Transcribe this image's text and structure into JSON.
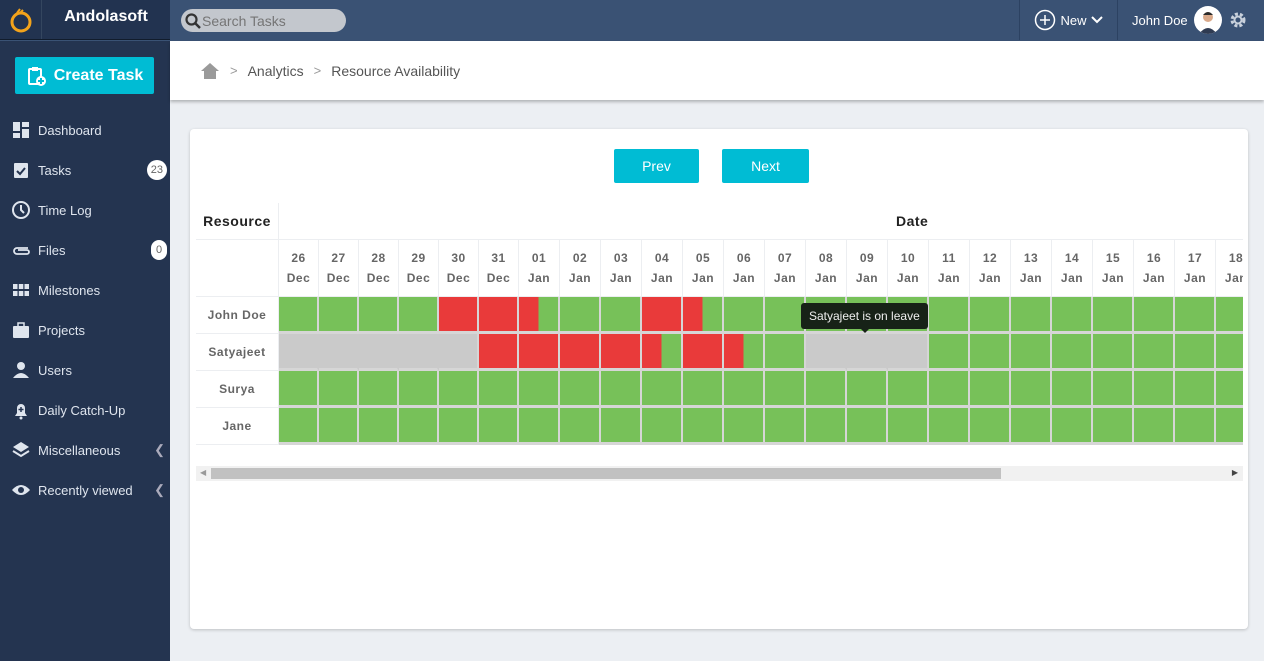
{
  "app": {
    "brand": "Andolasoft",
    "search_placeholder": "Search Tasks",
    "new_label": "New",
    "user_name": "John Doe"
  },
  "sidebar": {
    "create_label": "Create Task",
    "items": [
      {
        "label": "Dashboard",
        "icon": "dashboard-icon"
      },
      {
        "label": "Tasks",
        "icon": "clipboard-check-icon",
        "badge": "23"
      },
      {
        "label": "Time Log",
        "icon": "clock-icon"
      },
      {
        "label": "Files",
        "icon": "paperclip-icon",
        "badge": "0"
      },
      {
        "label": "Milestones",
        "icon": "grid-icon"
      },
      {
        "label": "Projects",
        "icon": "briefcase-icon"
      },
      {
        "label": "Users",
        "icon": "user-icon"
      },
      {
        "label": "Daily Catch-Up",
        "icon": "bell-plus-icon"
      },
      {
        "label": "Miscellaneous",
        "icon": "layers-icon",
        "expandable": true
      },
      {
        "label": "Recently viewed",
        "icon": "eye-icon",
        "expandable": true
      }
    ]
  },
  "breadcrumb": {
    "items": [
      "Analytics",
      "Resource Availability"
    ]
  },
  "nav_buttons": {
    "prev": "Prev",
    "next": "Next"
  },
  "table": {
    "resource_header": "Resource",
    "date_header": "Date",
    "dates": [
      [
        "26",
        "Dec"
      ],
      [
        "27",
        "Dec"
      ],
      [
        "28",
        "Dec"
      ],
      [
        "29",
        "Dec"
      ],
      [
        "30",
        "Dec"
      ],
      [
        "31",
        "Dec"
      ],
      [
        "01",
        "Jan"
      ],
      [
        "02",
        "Jan"
      ],
      [
        "03",
        "Jan"
      ],
      [
        "04",
        "Jan"
      ],
      [
        "05",
        "Jan"
      ],
      [
        "06",
        "Jan"
      ],
      [
        "07",
        "Jan"
      ],
      [
        "08",
        "Jan"
      ],
      [
        "09",
        "Jan"
      ],
      [
        "10",
        "Jan"
      ],
      [
        "11",
        "Jan"
      ],
      [
        "12",
        "Jan"
      ],
      [
        "13",
        "Jan"
      ],
      [
        "14",
        "Jan"
      ],
      [
        "15",
        "Jan"
      ],
      [
        "16",
        "Jan"
      ],
      [
        "17",
        "Jan"
      ],
      [
        "18",
        "Jan"
      ]
    ],
    "legend_status": {
      "g": "available",
      "r": "busy",
      "h": "half-busy",
      "l": "on-leave"
    },
    "rows": [
      {
        "name": "John Doe",
        "cells": [
          "g",
          "g",
          "g",
          "g",
          "r",
          "r",
          "h",
          "g",
          "g",
          "r",
          "h",
          "g",
          "g",
          "g",
          "g",
          "g",
          "g",
          "g",
          "g",
          "g",
          "g",
          "g",
          "g",
          "g"
        ]
      },
      {
        "name": "Satyajeet",
        "cells": [
          "l",
          "l",
          "l",
          "l",
          "l",
          "r",
          "r",
          "r",
          "r",
          "h",
          "r",
          "h",
          "g",
          "l",
          "l",
          "l",
          "g",
          "g",
          "g",
          "g",
          "g",
          "g",
          "g",
          "g"
        ]
      },
      {
        "name": "Surya",
        "cells": [
          "g",
          "g",
          "g",
          "g",
          "g",
          "g",
          "g",
          "g",
          "g",
          "g",
          "g",
          "g",
          "g",
          "g",
          "g",
          "g",
          "g",
          "g",
          "g",
          "g",
          "g",
          "g",
          "g",
          "g"
        ]
      },
      {
        "name": "Jane",
        "cells": [
          "g",
          "g",
          "g",
          "g",
          "g",
          "g",
          "g",
          "g",
          "g",
          "g",
          "g",
          "g",
          "g",
          "g",
          "g",
          "g",
          "g",
          "g",
          "g",
          "g",
          "g",
          "g",
          "g",
          "g"
        ]
      }
    ]
  },
  "tooltip": "Satyajeet is on leave",
  "colors": {
    "available": "#77c159",
    "busy": "#e93a3a",
    "leave": "#cacaca",
    "accent": "#00bcd4",
    "sidebar": "#243450",
    "topbar": "#3a5274"
  }
}
